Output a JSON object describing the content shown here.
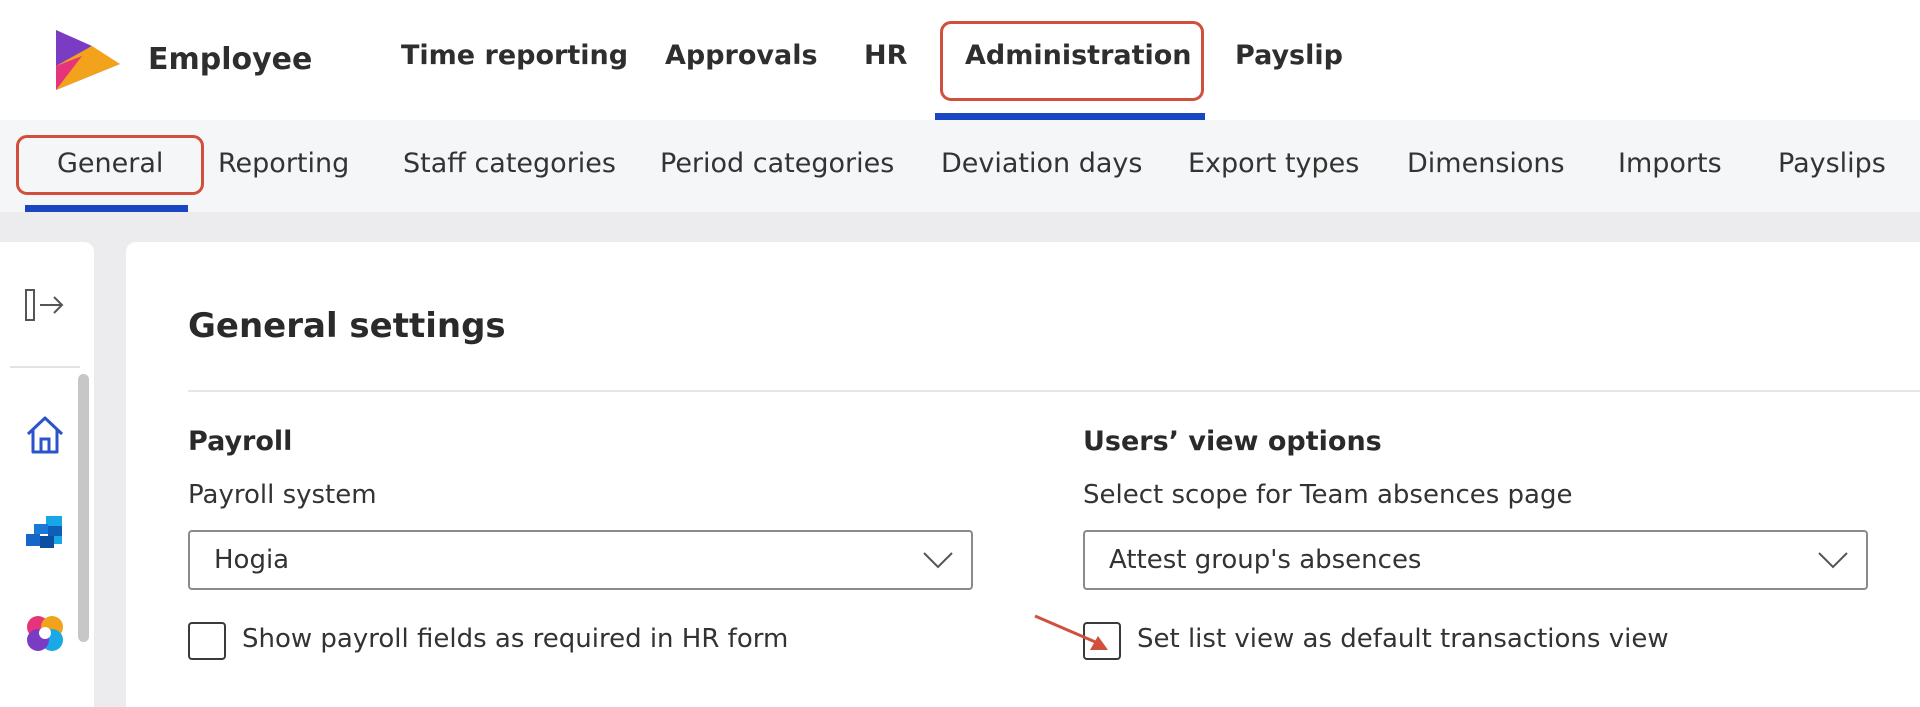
{
  "header": {
    "app_title": "Employee",
    "nav": [
      {
        "label": "Time reporting"
      },
      {
        "label": "Approvals"
      },
      {
        "label": "HR"
      },
      {
        "label": "Administration",
        "active": true
      },
      {
        "label": "Payslip"
      }
    ]
  },
  "subnav": {
    "items": [
      {
        "label": "General",
        "active": true
      },
      {
        "label": "Reporting"
      },
      {
        "label": "Staff categories"
      },
      {
        "label": "Period categories"
      },
      {
        "label": "Deviation days"
      },
      {
        "label": "Export types"
      },
      {
        "label": "Dimensions"
      },
      {
        "label": "Imports"
      },
      {
        "label": "Payslips"
      }
    ]
  },
  "sidebar": {
    "icons": [
      "expand-sidebar-icon",
      "home-icon",
      "blocks-app-icon",
      "colorful-app-icon"
    ]
  },
  "main": {
    "title": "General settings",
    "payroll": {
      "section_title": "Payroll",
      "field_label": "Payroll system",
      "selected": "Hogia",
      "checkbox_label": "Show payroll fields as required in HR form"
    },
    "view_options": {
      "section_title": "Users’ view options",
      "field_label": "Select scope for Team absences page",
      "selected": "Attest group's absences",
      "checkbox_label": "Set list view as default transactions view"
    }
  },
  "colors": {
    "accent_blue": "#1b46c2",
    "highlight_red": "#d0503d"
  }
}
